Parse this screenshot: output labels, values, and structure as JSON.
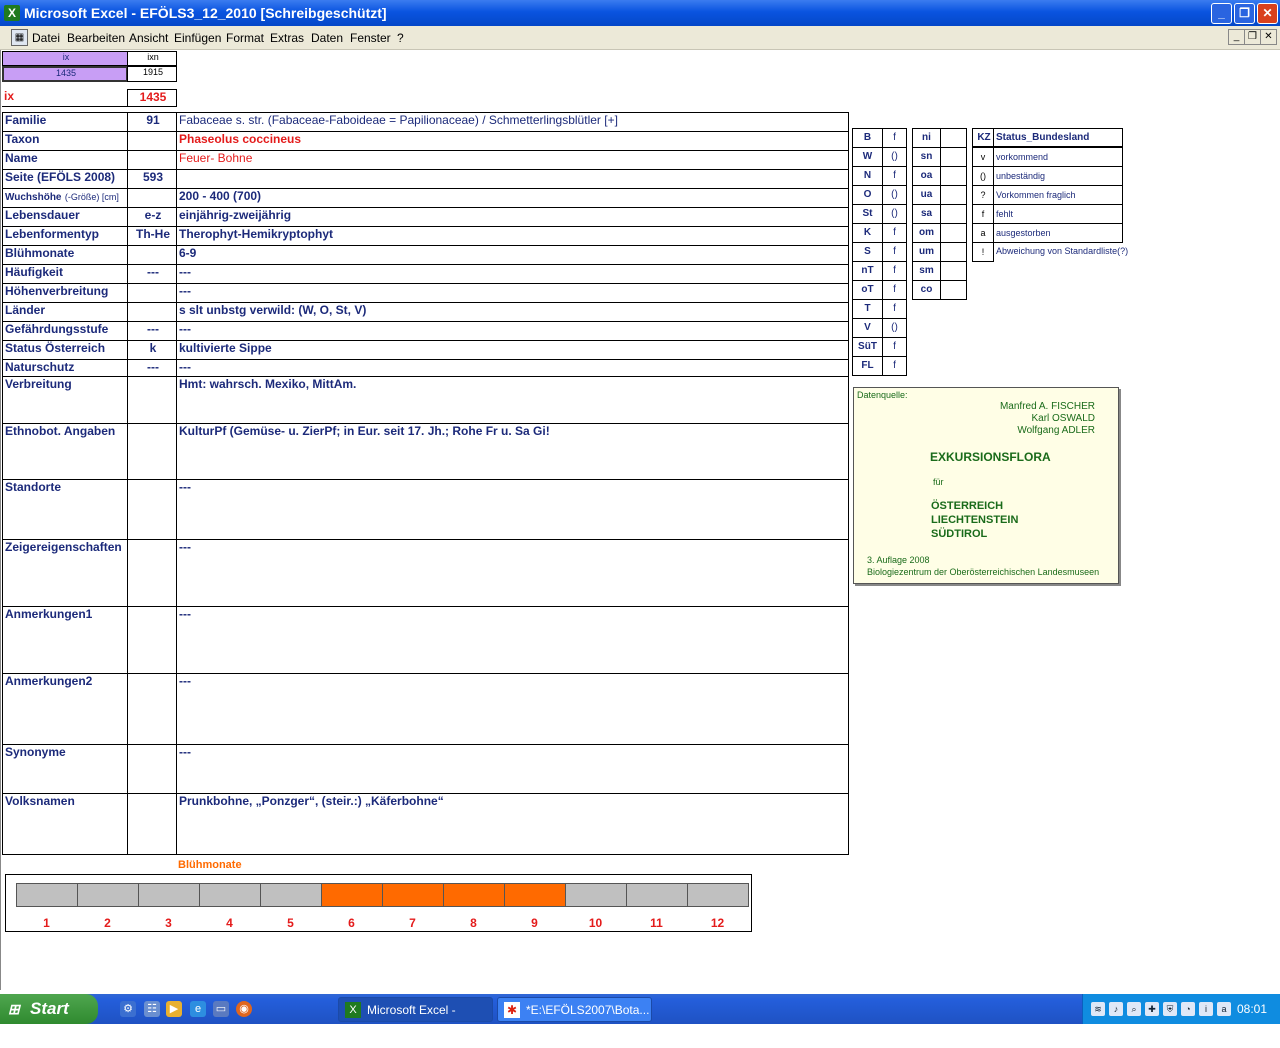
{
  "window": {
    "title": "Microsoft Excel - EFÖLS3_12_2010  [Schreibgeschützt]"
  },
  "menu": [
    "Datei",
    "Bearbeiten",
    "Ansicht",
    "Einfügen",
    "Format",
    "Extras",
    "Daten",
    "Fenster",
    "?"
  ],
  "header": {
    "ix_small_label": "ix",
    "ixn_small_label": "ixn",
    "ix_small_value": "1435",
    "ixn_small_value": "1915",
    "ix_label": "ix",
    "ix_value": "1435"
  },
  "rows": [
    {
      "label": "Familie",
      "code": "91",
      "value": "Fabaceae s. str. (Fabaceae-Faboideae = Papilionaceae)  /  Schmetterlingsblütler [+]"
    },
    {
      "label": "Taxon",
      "code": "",
      "value": "Phaseolus coccineus"
    },
    {
      "label": "Name",
      "code": "",
      "value": "Feuer- Bohne"
    },
    {
      "label": "Seite (EFÖLS 2008)",
      "code": "593",
      "value": ""
    },
    {
      "label": "Wuchshöhe",
      "label_suffix": "(-Größe) [cm]",
      "code": "",
      "value": "200 - 400 (700)"
    },
    {
      "label": "Lebensdauer",
      "code": "e-z",
      "value": "einjährig-zweijährig"
    },
    {
      "label": "Lebenformentyp",
      "code": "Th-He",
      "value": "Therophyt-Hemikryptophyt"
    },
    {
      "label": "Blühmonate",
      "code": "",
      "value": "6-9"
    },
    {
      "label": "Häufigkeit",
      "code": "---",
      "value": "---"
    },
    {
      "label": "Höhenverbreitung",
      "code": "",
      "value": "---"
    },
    {
      "label": "Länder",
      "code": "",
      "value": "s slt unbstg verwild: (W, O, St, V)"
    },
    {
      "label": "Gefährdungsstufe",
      "code": "---",
      "value": "---"
    },
    {
      "label": "Status Österreich",
      "code": "k",
      "value": "kultivierte Sippe"
    },
    {
      "label": "Naturschutz",
      "code": "---",
      "value": "---"
    },
    {
      "label": "Verbreitung",
      "code": "",
      "value": "Hmt: wahrsch. Mexiko, MittAm."
    },
    {
      "label": "Ethnobot. Angaben",
      "code": "",
      "value": "KulturPf (Gemüse- u. ZierPf; in Eur. seit 17. Jh.; Rohe Fr u. Sa Gi!"
    },
    {
      "label": "Standorte",
      "code": "",
      "value": "---"
    },
    {
      "label": "Zeigereigenschaften",
      "code": "",
      "value": "---"
    },
    {
      "label": "Anmerkungen1",
      "code": "",
      "value": "---"
    },
    {
      "label": "Anmerkungen2",
      "code": "",
      "value": "---"
    },
    {
      "label": "Synonyme",
      "code": "",
      "value": "---"
    },
    {
      "label": "Volksnamen",
      "code": "",
      "value": "Prunkbohne, „Ponzger“, (steir.:) „Käferbohne“"
    }
  ],
  "states": [
    {
      "code": "B",
      "status": "f"
    },
    {
      "code": "W",
      "status": "()"
    },
    {
      "code": "N",
      "status": "f"
    },
    {
      "code": "O",
      "status": "()"
    },
    {
      "code": "St",
      "status": "()"
    },
    {
      "code": "K",
      "status": "f"
    },
    {
      "code": "S",
      "status": "f"
    },
    {
      "code": "nT",
      "status": "f"
    },
    {
      "code": "oT",
      "status": "f"
    },
    {
      "code": "T",
      "status": "f"
    },
    {
      "code": "V",
      "status": "()"
    },
    {
      "code": "SüT",
      "status": "f"
    },
    {
      "code": "FL",
      "status": "f"
    }
  ],
  "regions": [
    {
      "code": "ni",
      "status": ""
    },
    {
      "code": "sn",
      "status": ""
    },
    {
      "code": "oa",
      "status": ""
    },
    {
      "code": "ua",
      "status": ""
    },
    {
      "code": "sa",
      "status": ""
    },
    {
      "code": "om",
      "status": ""
    },
    {
      "code": "um",
      "status": ""
    },
    {
      "code": "sm",
      "status": ""
    },
    {
      "code": "co",
      "status": ""
    }
  ],
  "legend": {
    "header_kz": "KZ",
    "header_title": "Status_Bundesland",
    "items": [
      {
        "kz": "v",
        "text": "vorkommend"
      },
      {
        "kz": "()",
        "text": "unbeständig"
      },
      {
        "kz": "?",
        "text": "Vorkommen fraglich"
      },
      {
        "kz": "f",
        "text": "fehlt"
      },
      {
        "kz": "a",
        "text": "ausgestorben"
      },
      {
        "kz": "!",
        "text": "Abweichung von Standardliste(?)"
      }
    ]
  },
  "data_source": {
    "label": "Datenquelle:",
    "authors": [
      "Manfred A. FISCHER",
      "Karl OSWALD",
      "Wolfgang ADLER"
    ],
    "title": "EXKURSIONSFLORA",
    "fuer": "für",
    "countries": [
      "ÖSTERREICH",
      "LIECHTENSTEIN",
      "SÜDTIROL"
    ],
    "edition": "3. Auflage 2008",
    "publisher": "Biologiezentrum der Oberösterreichischen Landesmuseen"
  },
  "bloom": {
    "title": "Blühmonate",
    "months": [
      "1",
      "2",
      "3",
      "4",
      "5",
      "6",
      "7",
      "8",
      "9",
      "10",
      "11",
      "12"
    ],
    "active": [
      false,
      false,
      false,
      false,
      false,
      true,
      true,
      true,
      true,
      false,
      false,
      false
    ],
    "active_color": "#ff6a00",
    "inactive_color": "#c0c0c0"
  },
  "taskbar": {
    "start": "Start",
    "tasks": [
      "Microsoft Excel - EFÖ...",
      "*E:\\EFÖLS2007\\Bota..."
    ],
    "clock": "08:01"
  }
}
